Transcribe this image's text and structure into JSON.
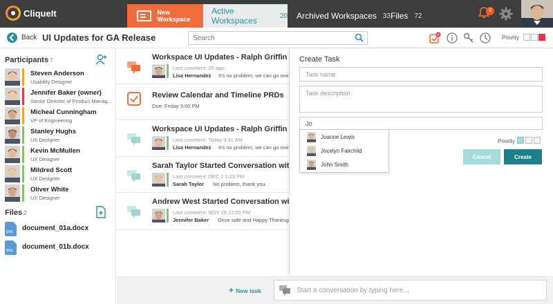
{
  "app": {
    "name": "CliqueIt"
  },
  "topnav": {
    "new_workspace": "New Workspace",
    "tabs": [
      {
        "label": "Active Workspaces",
        "count": "20"
      },
      {
        "label": "Archived Workspaces",
        "count": "33"
      },
      {
        "label": "Files",
        "count": "72"
      }
    ],
    "notifications_count": "3"
  },
  "header": {
    "back_label": "Back",
    "title": "UI Updates for GA Release",
    "search_placeholder": "Search",
    "priority_label": "Priority"
  },
  "sidebar": {
    "participants_title": "Participants",
    "participants_count": "7",
    "participants": [
      {
        "name": "Steven Anderson",
        "role": "Usability Designer",
        "color": "#f5a623"
      },
      {
        "name": "Jennifer Baker (owner)",
        "role": "Senior Director of Product Manag...",
        "color": "#e8334a"
      },
      {
        "name": "Micheal Cunningham",
        "role": "VP of Engineering",
        "color": "#f5a623"
      },
      {
        "name": "Stanley Hughs",
        "role": "UX Designer",
        "color": "#86c06d"
      },
      {
        "name": "Kevin McMullen",
        "role": "UX Designer",
        "color": "#86c06d"
      },
      {
        "name": "Mildred Scott",
        "role": "UX Designer",
        "color": "#86c06d"
      },
      {
        "name": "Oliver White",
        "role": "UX Designer",
        "color": "#86c06d"
      }
    ],
    "files_title": "Files",
    "files_count": "2",
    "files": [
      {
        "name": "document_01a.docx",
        "type": "doc"
      },
      {
        "name": "document_01b.docx",
        "type": "doc"
      }
    ]
  },
  "feed": {
    "items": [
      {
        "kind": "conversation-new",
        "title": "Workspace UI Updates - Ralph Griffin Started C",
        "meta": "Last comment: 2h ago",
        "who": "Lisa Hernandez",
        "msg": "It's no problem, we can go over it"
      },
      {
        "kind": "task",
        "title": "Review Calendar and Timeline PRDs",
        "due": "Due: Friday 5:00 PM"
      },
      {
        "kind": "conversation",
        "title": "Workspace UI Updates - Ralph Griffin Started C",
        "meta": "Last comment: Today 9:41 AM",
        "who": "Lisa Hernandez",
        "msg": "It's no problem, we can go over it"
      },
      {
        "kind": "conversation",
        "title": "Sarah Taylor Started Conversation with Everyon",
        "meta": "Last comment: DEC 2 1:23 PM",
        "who": "Sarah Taylor",
        "msg": "No problem, thank you."
      },
      {
        "kind": "conversation",
        "title": "Andrew West Started Conversation with Everyo",
        "meta": "Last comment: NOV 26 12:55 PM",
        "who": "Jennifer Baker",
        "msg": "Drive safe and Happy Thanksgiving."
      }
    ]
  },
  "footer": {
    "new_task": "New task",
    "conversation_placeholder": "Start a conversation by typing here..."
  },
  "create_task": {
    "title": "Create Task",
    "name_placeholder": "Task name",
    "description_placeholder": "Task description",
    "assignee_value": "Jo",
    "suggestions": [
      "Joanne Lewis",
      "Jocelyn Fairchild",
      "John Smith"
    ],
    "priority_label": "Priority",
    "cancel_label": "Cancel",
    "create_label": "Create"
  },
  "colors": {
    "accent": "#2a8f9a",
    "orange": "#f26b3a",
    "topbar": "#3d3d3d"
  }
}
